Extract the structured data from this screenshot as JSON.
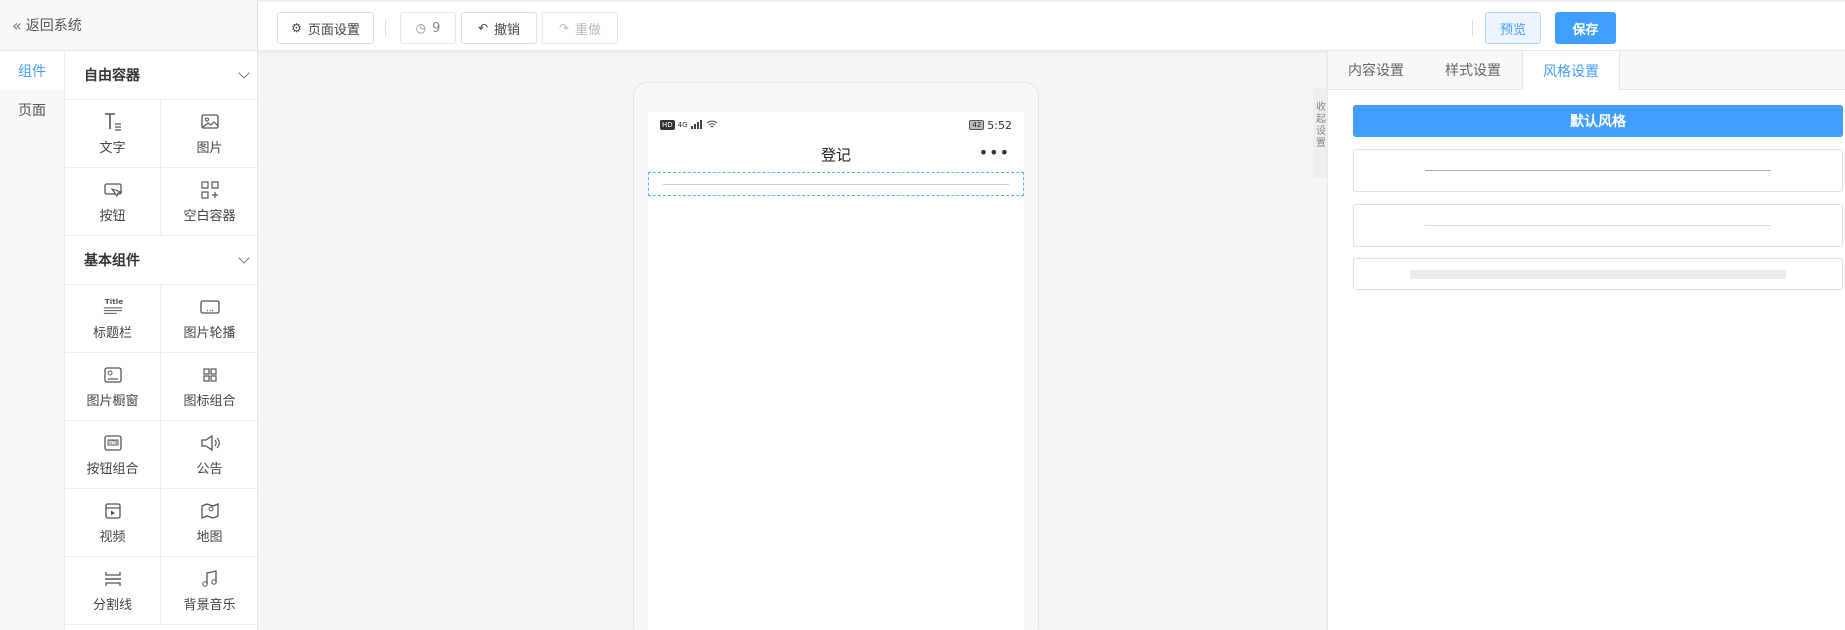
{
  "left": {
    "back_label": "返回系统",
    "tabs": [
      "组件",
      "页面"
    ],
    "categories": [
      {
        "title": "自由容器",
        "items": [
          {
            "label": "文字",
            "icon": "text-icon"
          },
          {
            "label": "图片",
            "icon": "image-icon"
          },
          {
            "label": "按钮",
            "icon": "button-icon"
          },
          {
            "label": "空白容器",
            "icon": "blank-container-icon"
          }
        ]
      },
      {
        "title": "基本组件",
        "items": [
          {
            "label": "标题栏",
            "icon": "title-bar-icon"
          },
          {
            "label": "图片轮播",
            "icon": "carousel-icon"
          },
          {
            "label": "图片橱窗",
            "icon": "image-showcase-icon"
          },
          {
            "label": "图标组合",
            "icon": "icon-group-icon"
          },
          {
            "label": "按钮组合",
            "icon": "button-group-icon"
          },
          {
            "label": "公告",
            "icon": "announcement-icon"
          },
          {
            "label": "视频",
            "icon": "video-icon"
          },
          {
            "label": "地图",
            "icon": "map-icon"
          },
          {
            "label": "分割线",
            "icon": "divider-icon"
          },
          {
            "label": "背景音乐",
            "icon": "music-icon"
          }
        ]
      }
    ]
  },
  "toolbar": {
    "page_settings": "页面设置",
    "history_count": "9",
    "undo": "撤销",
    "redo": "重做",
    "preview": "预览",
    "save": "保存"
  },
  "phone": {
    "status_time": "5:52",
    "battery": "42",
    "hd_badge": "HD",
    "network": "4G",
    "page_title": "登记",
    "more": "•••"
  },
  "collapse_handle_text": "收起设置",
  "right": {
    "tabs": [
      "内容设置",
      "样式设置",
      "风格设置"
    ],
    "active_tab_index": 2,
    "default_style_button": "默认风格"
  },
  "colors": {
    "accent": "#409eff",
    "selection_border": "#4fb3ff"
  }
}
